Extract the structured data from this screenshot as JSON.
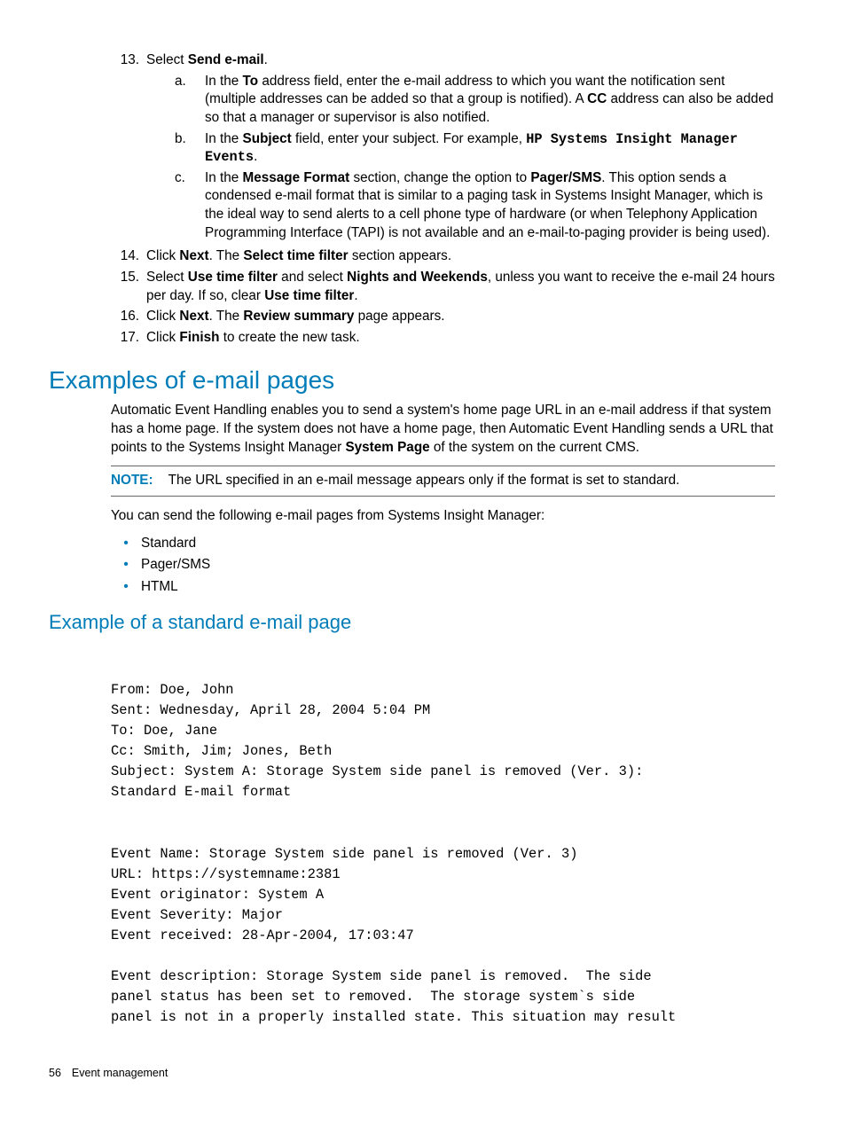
{
  "steps": {
    "s13": {
      "num": "13.",
      "text_pre": "Select ",
      "bold1": "Send e-mail",
      "text_post": ".",
      "sub": {
        "a": {
          "num": "a.",
          "p1": "In the ",
          "b1": "To",
          "p2": " address field, enter the e-mail address to which you want the notification sent (multiple addresses can be added so that a group is notified). A ",
          "b2": "CC",
          "p3": " address can also be added so that a manager or supervisor is also notified."
        },
        "b": {
          "num": "b.",
          "p1": "In the ",
          "b1": "Subject",
          "p2": " field, enter your subject. For example, ",
          "code": "HP Systems Insight Manager Events",
          "p3": "."
        },
        "c": {
          "num": "c.",
          "p1": "In the ",
          "b1": "Message Format",
          "p2": " section, change the option to ",
          "b2": "Pager/SMS",
          "p3": ". This option sends a condensed e-mail format that is similar to a paging task in Systems Insight Manager, which is the ideal way to send alerts to a cell phone type of hardware (or when Telephony Application Programming Interface (TAPI) is not available and an e-mail-to-paging provider is being used)."
        }
      }
    },
    "s14": {
      "num": "14.",
      "p1": "Click ",
      "b1": "Next",
      "p2": ". The ",
      "b2": "Select time filter",
      "p3": " section appears."
    },
    "s15": {
      "num": "15.",
      "p1": "Select ",
      "b1": "Use time filter",
      "p2": " and select ",
      "b2": "Nights and Weekends",
      "p3": ", unless you want to receive the e-mail 24 hours per day. If so, clear ",
      "b3": "Use time filter",
      "p4": "."
    },
    "s16": {
      "num": "16.",
      "p1": "Click ",
      "b1": "Next",
      "p2": ". The ",
      "b2": "Review summary",
      "p3": " page appears."
    },
    "s17": {
      "num": "17.",
      "p1": "Click ",
      "b1": "Finish",
      "p2": " to create the new task."
    }
  },
  "h2_examples": "Examples of e-mail pages",
  "para1_p1": "Automatic Event Handling enables you to send a system's home page URL in an e-mail address if that system has a home page. If the system does not have a home page, then Automatic Event Handling sends a URL that points to the Systems Insight Manager ",
  "para1_b1": "System Page",
  "para1_p2": " of the system on the current CMS.",
  "note_label": "NOTE:",
  "note_text": "The URL specified in an e-mail message appears only if the format is set to standard.",
  "para2": "You can send the following e-mail pages from Systems Insight Manager:",
  "bullets": [
    "Standard",
    "Pager/SMS",
    "HTML"
  ],
  "h3_std": "Example of a standard e-mail page",
  "email": "From: Doe, John\nSent: Wednesday, April 28, 2004 5:04 PM\nTo: Doe, Jane\nCc: Smith, Jim; Jones, Beth\nSubject: System A: Storage System side panel is removed (Ver. 3):\nStandard E-mail format\n\n\nEvent Name: Storage System side panel is removed (Ver. 3)\nURL: https://systemname:2381\nEvent originator: System A\nEvent Severity: Major\nEvent received: 28-Apr-2004, 17:03:47\n\nEvent description: Storage System side panel is removed.  The side\npanel status has been set to removed.  The storage system`s side\npanel is not in a properly installed state. This situation may result",
  "footer_page": "56",
  "footer_title": "Event management"
}
